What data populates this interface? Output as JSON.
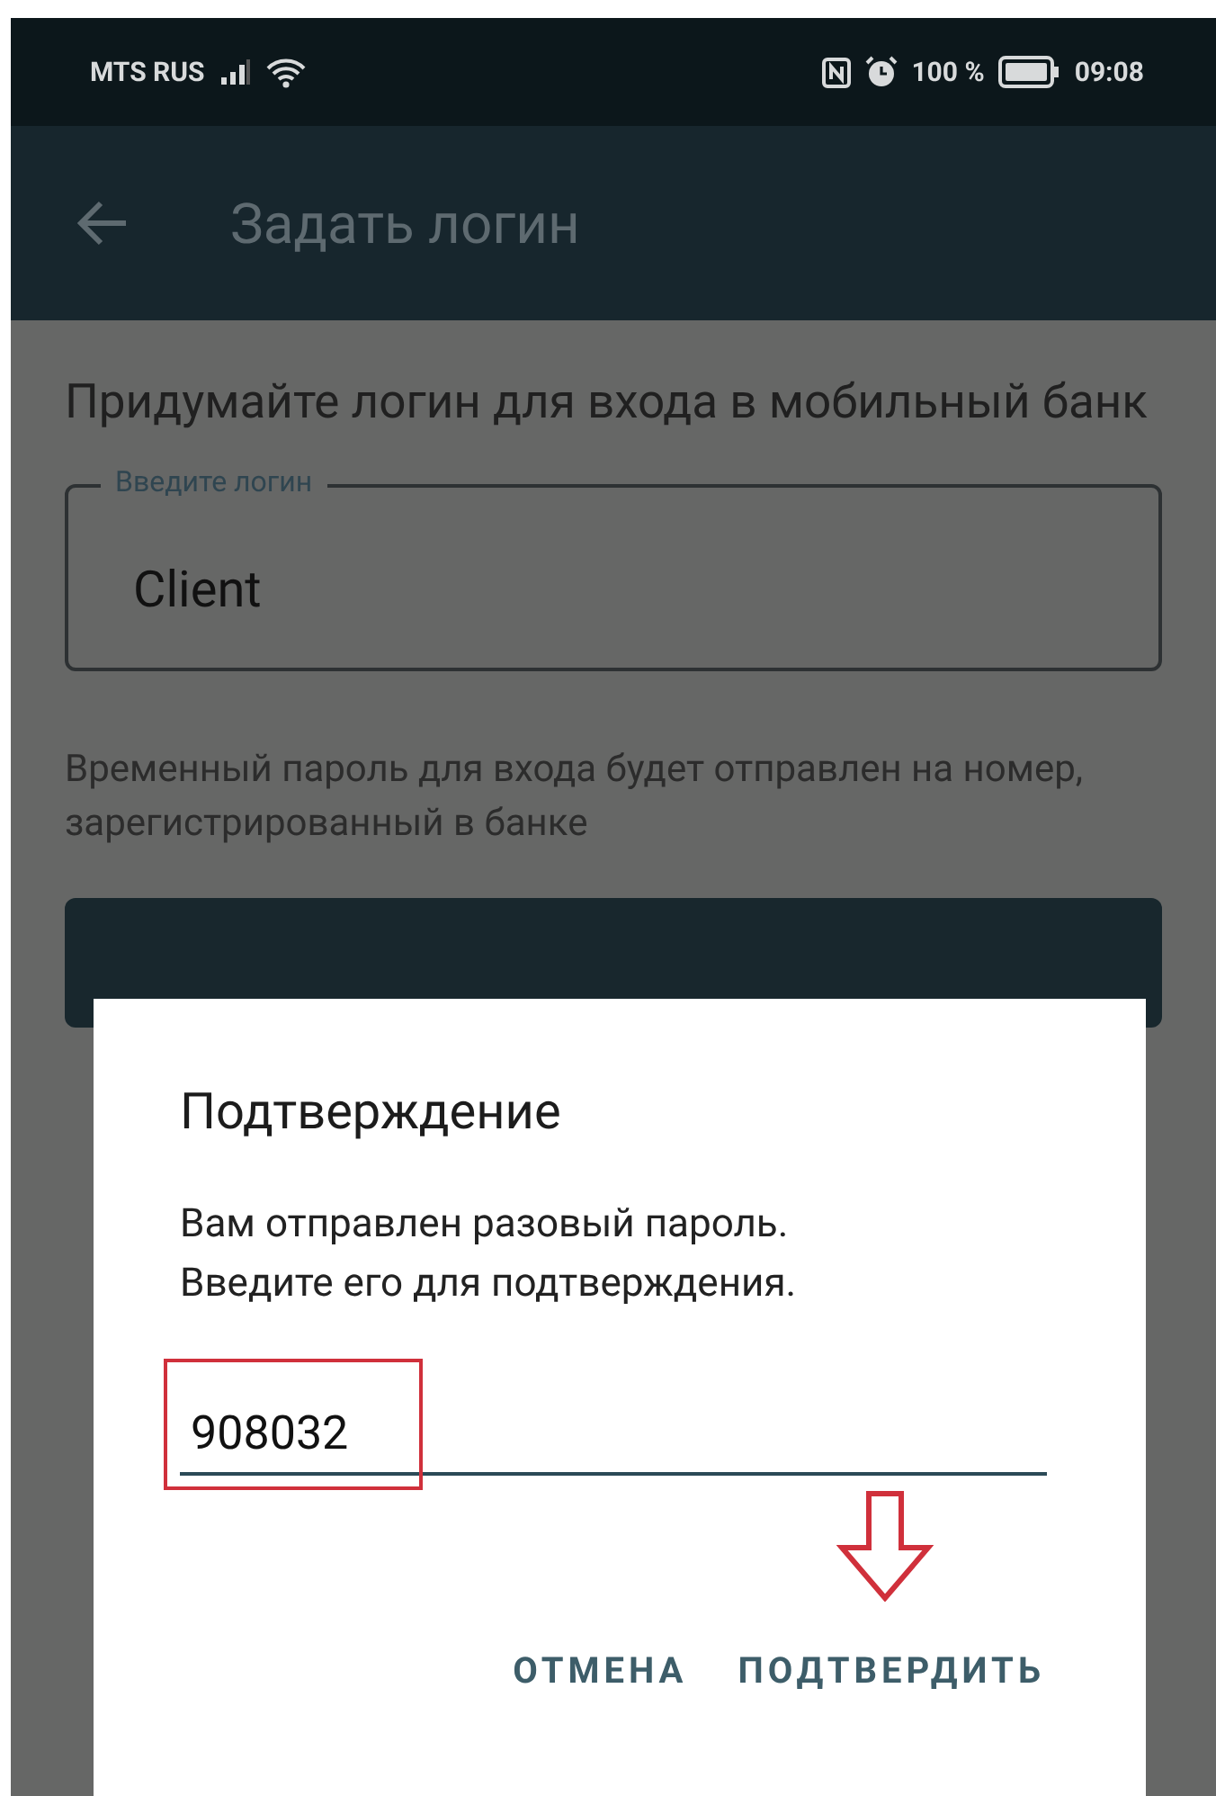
{
  "status_bar": {
    "carrier": "MTS RUS",
    "battery": "100 %",
    "time": "09:08"
  },
  "app_bar": {
    "title": "Задать логин"
  },
  "content": {
    "intro": "Придумайте логин для входа в мобильный банк",
    "login_field": {
      "label": "Введите логин",
      "value": "Client"
    },
    "hint": "Временный пароль для входа будет отправлен на номер, зарегистрированный в банке"
  },
  "dialog": {
    "title": "Подтверждение",
    "message": [
      "Вам отправлен разовый пароль.",
      "Введите его для подтверждения."
    ],
    "code_field": {
      "value": "908032"
    },
    "buttons": [
      "ОТМЕНА",
      "ПОДТВЕРДИТЬ"
    ]
  }
}
